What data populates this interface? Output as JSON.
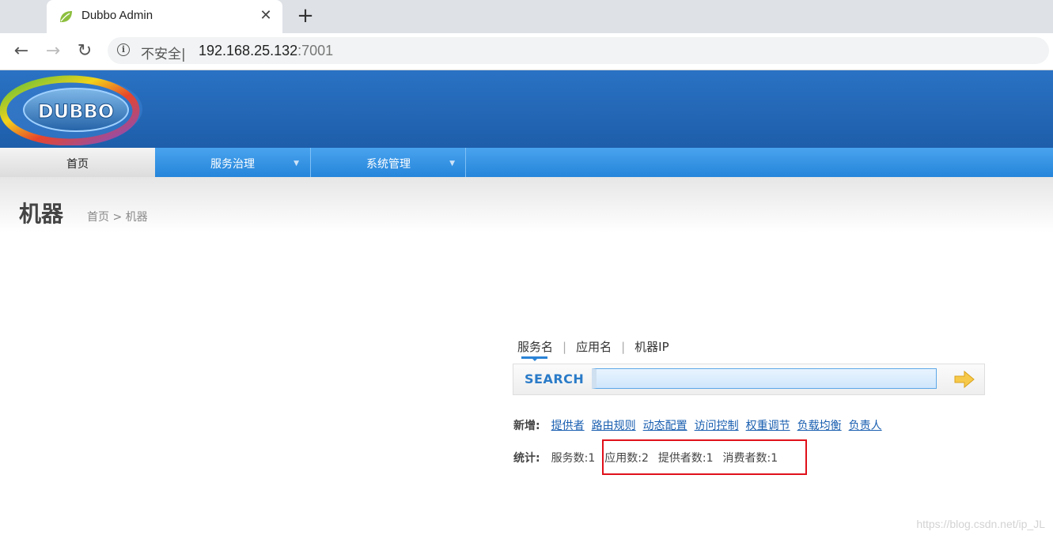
{
  "browser": {
    "tab_title": "Dubbo Admin",
    "close_glyph": "✕",
    "new_tab_glyph": "+",
    "back_glyph": "←",
    "forward_glyph": "→",
    "reload_glyph": "↻",
    "security_label": "不安全",
    "url_separator": "|",
    "url_host": "192.168.25.132",
    "url_port": ":7001"
  },
  "header": {
    "logo_text": "DUBBO"
  },
  "menu": {
    "items": [
      {
        "label": "首页",
        "active": true
      },
      {
        "label": "服务治理",
        "caret": "▼"
      },
      {
        "label": "系统管理",
        "caret": "▼"
      }
    ]
  },
  "page": {
    "title": "机器",
    "breadcrumb": "首页 > 机器"
  },
  "search": {
    "tabs": [
      "服务名",
      "应用名",
      "机器IP"
    ],
    "tab_separator": "|",
    "label": "SEARCH",
    "placeholder": ""
  },
  "add_row": {
    "label": "新增:",
    "links": [
      "提供者",
      "路由规则",
      "动态配置",
      "访问控制",
      "权重调节",
      "负载均衡",
      "负责人"
    ]
  },
  "stats_row": {
    "label": "统计:",
    "items": [
      "服务数:1",
      "应用数:2",
      "提供者数:1",
      "消费者数:1"
    ]
  },
  "watermark": "https://blog.csdn.net/ip_JL",
  "colors": {
    "banner": "#1e5eaa",
    "menubar": "#2585da",
    "link": "#1a5fb0",
    "highlight": "#e0101a"
  }
}
